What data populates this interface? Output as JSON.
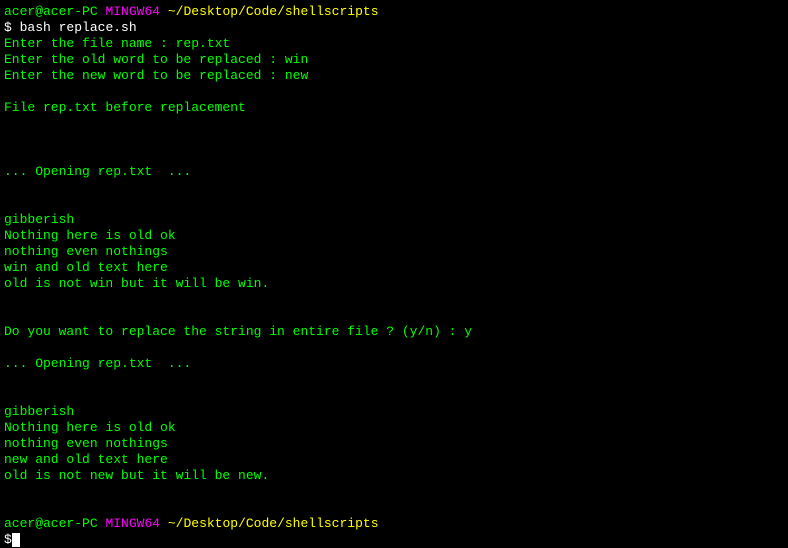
{
  "prompt1": {
    "user_host": "acer@acer-PC",
    "shell": "MINGW64",
    "path": "~/Desktop/Code/shellscripts",
    "symbol": "$"
  },
  "cmd1": "bash replace.sh",
  "out": {
    "l1": "Enter the file name : rep.txt",
    "l2": "Enter the old word to be replaced : win",
    "l3": "Enter the new word to be replaced : new",
    "l4": "File rep.txt before replacement",
    "l5": "... Opening rep.txt  ...",
    "l6": "gibberish",
    "l7": "Nothing here is old ok",
    "l8": "nothing even nothings",
    "l9": "win and old text here",
    "l10": "old is not win but it will be win.",
    "l11": "Do you want to replace the string in entire file ? (y/n) : y",
    "l12": "... Opening rep.txt  ...",
    "l13": "gibberish",
    "l14": "Nothing here is old ok",
    "l15": "nothing even nothings",
    "l16": "new and old text here",
    "l17": "old is not new but it will be new."
  },
  "prompt2": {
    "user_host": "acer@acer-PC",
    "shell": "MINGW64",
    "path": "~/Desktop/Code/shellscripts",
    "symbol": "$"
  }
}
